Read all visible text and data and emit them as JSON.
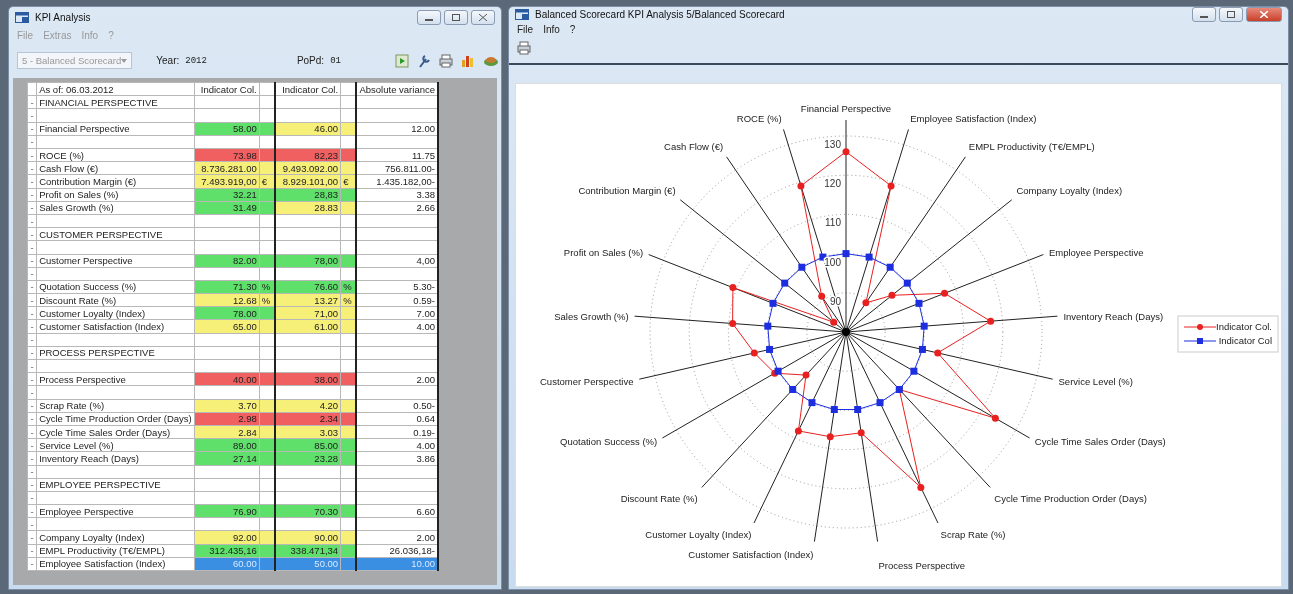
{
  "left_window": {
    "title": "KPI Analysis",
    "menu": [
      {
        "label": "File",
        "disabled": true
      },
      {
        "label": "Extras",
        "disabled": true
      },
      {
        "label": "Info",
        "disabled": true
      },
      {
        "label": "?",
        "disabled": true
      }
    ],
    "toolbar": {
      "scenario": {
        "value": "5 - Balanced Scorecard",
        "disabled": true
      },
      "year_label": "Year:",
      "year": "2012",
      "period_label": "PoPd:",
      "period": "01"
    }
  },
  "table": {
    "columns": [
      "As of: 06.03.2012",
      "Indicator Col.",
      "Indicator Col.",
      "Absolute variance"
    ],
    "rows": [
      {
        "kind": "section",
        "marker": "-",
        "label": "FINANCIAL PERSPECTIVE",
        "selected": false
      },
      {
        "kind": "blank",
        "marker": "-",
        "selected": false
      },
      {
        "kind": "kpi",
        "marker": "-",
        "label": "Financial Perspective",
        "value_1": {
          "text": "58.00",
          "color": "#5fe06a"
        },
        "value_2": {
          "text": "46.00",
          "color": "#f6ef78"
        },
        "variance": "12.00",
        "selected": false
      },
      {
        "kind": "blank",
        "marker": "-",
        "selected": false
      },
      {
        "kind": "kpi",
        "marker": "-",
        "label": "ROCE (%)",
        "value_1": {
          "text": "73.98",
          "color": "#f06060"
        },
        "value_2": {
          "text": "82,23",
          "color": "#f06060"
        },
        "variance": "11.75",
        "selected": false
      },
      {
        "kind": "kpi",
        "marker": "-",
        "label": "Cash Flow (€)",
        "value_1": {
          "text": "8.736.281.00",
          "color": "#f6ef78"
        },
        "value_2": {
          "text": "9.493.092.00",
          "color": "#f6ef78"
        },
        "variance": "756.811.00-",
        "selected": false
      },
      {
        "kind": "kpi",
        "marker": "-",
        "label": "Contribution Margin (€)",
        "value_1": {
          "text": "7.493.919,00",
          "color": "#f6ef78",
          "unit": "€"
        },
        "value_2": {
          "text": "8.929.101,00",
          "color": "#f6ef78",
          "unit": "€"
        },
        "variance": "1.435.182,00-",
        "selected": false
      },
      {
        "kind": "kpi",
        "marker": "-",
        "label": "Profit on Sales (%)",
        "value_1": {
          "text": "32.21",
          "color": "#5fe06a"
        },
        "value_2": {
          "text": "28,83",
          "color": "#5fe06a"
        },
        "variance": "3.38",
        "selected": false
      },
      {
        "kind": "kpi",
        "marker": "-",
        "label": "Sales Growth (%)",
        "value_1": {
          "text": "31.49",
          "color": "#5fe06a"
        },
        "value_2": {
          "text": "28.83",
          "color": "#f6ef78"
        },
        "variance": "2.66",
        "selected": false
      },
      {
        "kind": "blank",
        "marker": "-",
        "selected": false
      },
      {
        "kind": "section",
        "marker": "-",
        "label": "CUSTOMER PERSPECTIVE",
        "selected": false
      },
      {
        "kind": "blank",
        "marker": "-",
        "selected": false
      },
      {
        "kind": "kpi",
        "marker": "-",
        "label": "Customer Perspective",
        "value_1": {
          "text": "82.00",
          "color": "#5fe06a"
        },
        "value_2": {
          "text": "78,00",
          "color": "#5fe06a"
        },
        "variance": "4,00",
        "selected": false
      },
      {
        "kind": "blank",
        "marker": "-",
        "selected": false
      },
      {
        "kind": "kpi",
        "marker": "-",
        "label": "Quotation Success (%)",
        "value_1": {
          "text": "71.30",
          "color": "#5fe06a",
          "unit": "%"
        },
        "value_2": {
          "text": "76.60",
          "color": "#5fe06a",
          "unit": "%"
        },
        "variance": "5.30-",
        "selected": false
      },
      {
        "kind": "kpi",
        "marker": "-",
        "label": "Discount Rate (%)",
        "value_1": {
          "text": "12.68",
          "color": "#f6ef78",
          "unit": "%"
        },
        "value_2": {
          "text": "13.27",
          "color": "#f6ef78",
          "unit": "%"
        },
        "variance": "0.59-",
        "selected": false
      },
      {
        "kind": "kpi",
        "marker": "-",
        "label": "Customer Loyalty (Index)",
        "value_1": {
          "text": "78.00",
          "color": "#5fe06a"
        },
        "value_2": {
          "text": "71,00",
          "color": "#f6ef78"
        },
        "variance": "7.00",
        "selected": false
      },
      {
        "kind": "kpi",
        "marker": "-",
        "label": "Customer Satisfaction (Index)",
        "value_1": {
          "text": "65.00",
          "color": "#f6ef78"
        },
        "value_2": {
          "text": "61.00",
          "color": "#f6ef78"
        },
        "variance": "4.00",
        "selected": false
      },
      {
        "kind": "blank",
        "marker": "-",
        "selected": false
      },
      {
        "kind": "section",
        "marker": "-",
        "label": "PROCESS PERSPECTIVE",
        "selected": false
      },
      {
        "kind": "blank",
        "marker": "-",
        "selected": false
      },
      {
        "kind": "kpi",
        "marker": "-",
        "label": "Process Perspective",
        "value_1": {
          "text": "40.00",
          "color": "#f06060"
        },
        "value_2": {
          "text": "38.00",
          "color": "#f06060"
        },
        "variance": "2.00",
        "selected": false
      },
      {
        "kind": "blank",
        "marker": "-",
        "selected": false
      },
      {
        "kind": "kpi",
        "marker": "-",
        "label": "Scrap Rate (%)",
        "value_1": {
          "text": "3.70",
          "color": "#f6ef78"
        },
        "value_2": {
          "text": "4.20",
          "color": "#f6ef78"
        },
        "variance": "0.50-",
        "selected": false
      },
      {
        "kind": "kpi",
        "marker": "-",
        "label": "Cycle Time Production Order (Days)",
        "value_1": {
          "text": "2.98",
          "color": "#f06060"
        },
        "value_2": {
          "text": "2.34",
          "color": "#f06060"
        },
        "variance": "0.64",
        "selected": false
      },
      {
        "kind": "kpi",
        "marker": "-",
        "label": "Cycle Time Sales Order (Days)",
        "value_1": {
          "text": "2.84",
          "color": "#f6ef78"
        },
        "value_2": {
          "text": "3.03",
          "color": "#f6ef78"
        },
        "variance": "0.19-",
        "selected": false
      },
      {
        "kind": "kpi",
        "marker": "-",
        "label": "Service Level (%)",
        "value_1": {
          "text": "89.00",
          "color": "#5fe06a"
        },
        "value_2": {
          "text": "85.00",
          "color": "#5fe06a"
        },
        "variance": "4.00",
        "selected": false
      },
      {
        "kind": "kpi",
        "marker": "-",
        "label": "Inventory Reach (Days)",
        "value_1": {
          "text": "27.14",
          "color": "#5fe06a"
        },
        "value_2": {
          "text": "23.28",
          "color": "#5fe06a"
        },
        "variance": "3.86",
        "selected": false
      },
      {
        "kind": "blank",
        "marker": "-",
        "selected": false
      },
      {
        "kind": "section",
        "marker": "-",
        "label": "EMPLOYEE PERSPECTIVE",
        "selected": false
      },
      {
        "kind": "blank",
        "marker": "-",
        "selected": false
      },
      {
        "kind": "kpi",
        "marker": "-",
        "label": "Employee Perspective",
        "value_1": {
          "text": "76.90",
          "color": "#5fe06a"
        },
        "value_2": {
          "text": "70.30",
          "color": "#5fe06a"
        },
        "variance": "6.60",
        "selected": false
      },
      {
        "kind": "blank",
        "marker": "-",
        "selected": false
      },
      {
        "kind": "kpi",
        "marker": "-",
        "label": "Company Loyalty (Index)",
        "value_1": {
          "text": "92.00",
          "color": "#f6ef78"
        },
        "value_2": {
          "text": "90.00",
          "color": "#f6ef78"
        },
        "variance": "2.00",
        "selected": false
      },
      {
        "kind": "kpi",
        "marker": "-",
        "label": "EMPL Productivity (T€/EMPL)",
        "value_1": {
          "text": "312.435,16",
          "color": "#5fe06a"
        },
        "value_2": {
          "text": "338.471,34",
          "color": "#5fe06a"
        },
        "variance": "26.036,18-",
        "selected": false
      },
      {
        "kind": "kpi",
        "marker": "-",
        "label": "Employee Satisfaction (Index)",
        "value_1": {
          "text": "60.00",
          "color": "#3b8fe2"
        },
        "value_2": {
          "text": "50.00",
          "color": "#3b8fe2"
        },
        "variance": "10.00",
        "selected": true
      }
    ]
  },
  "right_window": {
    "title": "Balanced Scorecard KPI Analysis 5/Balanced Scorecard",
    "menu": [
      {
        "label": "File",
        "disabled": false
      },
      {
        "label": "Info",
        "disabled": false
      },
      {
        "label": "?",
        "disabled": false
      }
    ],
    "radar_chart": {
      "right_axis_labels": [
        "Financial Perspective",
        "Employee Satisfaction (Index)",
        "EMPL Productivity (T€/EMPL)",
        "Company Loyalty (Index)",
        "Employee Perspective",
        "Inventory Reach (Days)",
        "Service Level (%)",
        "Cycle Time Sales Order (Days)",
        "Cycle Time Production Order (Days)",
        "Scrap Rate (%)",
        "Process Perspective"
      ],
      "left_axis_labels": [
        "ROCE (%)",
        "Cash Flow (€)",
        "Contribution Margin (€)",
        "Profit on Sales (%)",
        "Sales Growth (%)",
        "Customer Perspective",
        "Quotation Success (%)",
        "Discount Rate (%)",
        "Customer Loyalty (Index)",
        "Customer Satisfaction (Index)"
      ],
      "tick_labels": [
        "130",
        "120",
        "110",
        "100",
        "90"
      ],
      "legend": [
        {
          "label": "Indicator Col.",
          "color": "#e82020",
          "kind": "circle"
        },
        {
          "label": "Indicator Col",
          "color": "#1c2ee0",
          "kind": "square"
        }
      ]
    }
  }
}
